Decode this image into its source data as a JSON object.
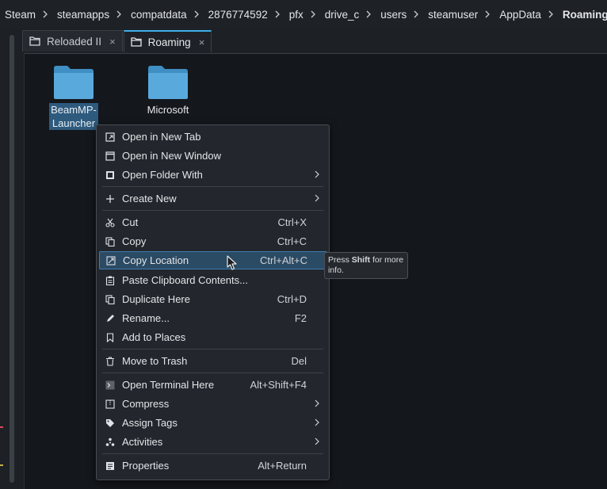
{
  "breadcrumb": {
    "items": [
      "Steam",
      "steamapps",
      "compatdata",
      "2876774592",
      "pfx",
      "drive_c",
      "users",
      "steamuser",
      "AppData",
      "Roaming"
    ],
    "separator_icon": "chevron-right-icon"
  },
  "tabs": [
    {
      "label": "Reloaded II",
      "icon": "folder-tab-icon",
      "close": "×",
      "active": false
    },
    {
      "label": "Roaming",
      "icon": "folder-tab-icon",
      "close": "×",
      "active": true
    }
  ],
  "files": [
    {
      "label_lines": [
        "BeamMP-",
        "Launcher"
      ],
      "icon": "folder-icon",
      "selected": true
    },
    {
      "label_lines": [
        "Microsoft"
      ],
      "icon": "folder-icon",
      "selected": false
    }
  ],
  "context_menu": {
    "items": [
      {
        "label": "Open in New Tab",
        "shortcut": "",
        "icon": "open-tab-icon",
        "submenu": false
      },
      {
        "label": "Open in New Window",
        "shortcut": "",
        "icon": "open-window-icon",
        "submenu": false
      },
      {
        "label": "Open Folder With",
        "shortcut": "",
        "icon": "open-with-icon",
        "submenu": true
      },
      {
        "label": "Create New",
        "shortcut": "",
        "icon": "plus-icon",
        "submenu": true
      },
      {
        "label": "Cut",
        "shortcut": "Ctrl+X",
        "icon": "scissors-icon",
        "submenu": false
      },
      {
        "label": "Copy",
        "shortcut": "Ctrl+C",
        "icon": "copy-icon",
        "submenu": false
      },
      {
        "label": "Copy Location",
        "shortcut": "Ctrl+Alt+C",
        "icon": "copy-location-icon",
        "submenu": false,
        "highlighted": true
      },
      {
        "label": "Paste Clipboard Contents...",
        "shortcut": "",
        "icon": "paste-icon",
        "submenu": false
      },
      {
        "label": "Duplicate Here",
        "shortcut": "Ctrl+D",
        "icon": "duplicate-icon",
        "submenu": false
      },
      {
        "label": "Rename...",
        "shortcut": "F2",
        "icon": "pencil-icon",
        "submenu": false
      },
      {
        "label": "Add to Places",
        "shortcut": "",
        "icon": "bookmark-icon",
        "submenu": false
      },
      {
        "label": "Move to Trash",
        "shortcut": "Del",
        "icon": "trash-icon",
        "submenu": false
      },
      {
        "label": "Open Terminal Here",
        "shortcut": "Alt+Shift+F4",
        "icon": "terminal-icon",
        "submenu": false
      },
      {
        "label": "Compress",
        "shortcut": "",
        "icon": "archive-icon",
        "submenu": true
      },
      {
        "label": "Assign Tags",
        "shortcut": "",
        "icon": "tag-icon",
        "submenu": true
      },
      {
        "label": "Activities",
        "shortcut": "",
        "icon": "activities-icon",
        "submenu": true
      },
      {
        "label": "Properties",
        "shortcut": "Alt+Return",
        "icon": "properties-icon",
        "submenu": false
      }
    ]
  },
  "tooltip": {
    "prefix": "Press ",
    "key": "Shift",
    "suffix": " for more info."
  },
  "colors": {
    "accent": "#3daee9",
    "folder": "#4b9fd5",
    "selection": "#2e5a7d",
    "menu_highlight": "#2b4a63"
  }
}
